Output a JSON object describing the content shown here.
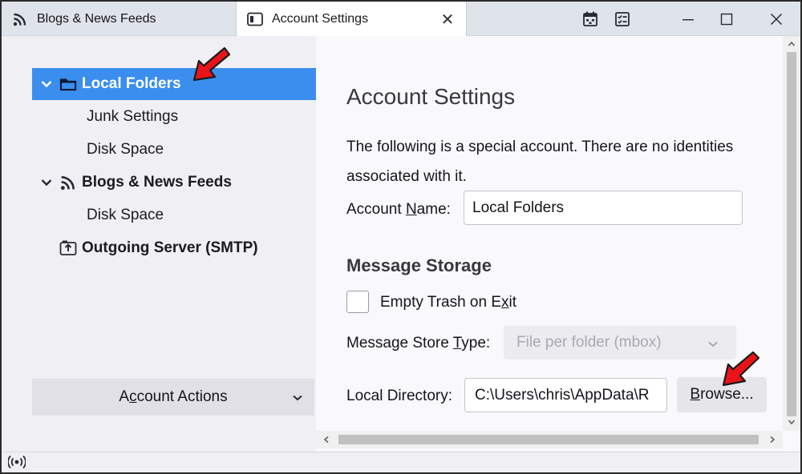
{
  "tabs": [
    {
      "label": "Blogs & News Feeds",
      "icon": "rss-icon"
    },
    {
      "label": "Account Settings",
      "icon": "account-settings-icon",
      "close_glyph": "✕"
    }
  ],
  "window_controls": {
    "calendar_icon": "calendar-icon",
    "tasks_icon": "tasks-icon",
    "minimize": "—",
    "maximize": "☐",
    "close": "✕"
  },
  "sidebar": {
    "items": [
      {
        "label": "Local Folders",
        "type": "account",
        "icon": "folder-icon",
        "expanded": true,
        "selected": true
      },
      {
        "label": "Junk Settings",
        "type": "child"
      },
      {
        "label": "Disk Space",
        "type": "child"
      },
      {
        "label": "Blogs & News Feeds",
        "type": "account",
        "icon": "rss-icon",
        "expanded": true
      },
      {
        "label": "Disk Space",
        "type": "child"
      },
      {
        "label": "Outgoing Server (SMTP)",
        "type": "account",
        "icon": "outgoing-server-icon"
      }
    ],
    "account_actions": {
      "label_pre": "A",
      "label_underlined": "c",
      "label_post": "count Actions",
      "chevron": "⌄"
    }
  },
  "main": {
    "title": "Account Settings",
    "description": "The following is a special account. There are no identities associated with it.",
    "account_name": {
      "label_pre": "Account ",
      "label_underlined": "N",
      "label_post": "ame:",
      "value": "Local Folders"
    },
    "message_storage_heading": "Message Storage",
    "empty_trash": {
      "label_pre": "Empty Trash on E",
      "label_underlined": "x",
      "label_post": "it",
      "checked": false
    },
    "store_type": {
      "label_pre": "Message Store ",
      "label_underlined": "T",
      "label_post": "ype:",
      "value": "File per folder (mbox)",
      "disabled": true
    },
    "local_directory": {
      "label": "Local Directory:",
      "value": "C:\\Users\\chris\\AppData\\R"
    },
    "browse_button": {
      "label_underlined": "B",
      "label_post": "rowse..."
    }
  },
  "colors": {
    "selection": "#3b8eed",
    "annotation_arrow": "#e8141a"
  }
}
